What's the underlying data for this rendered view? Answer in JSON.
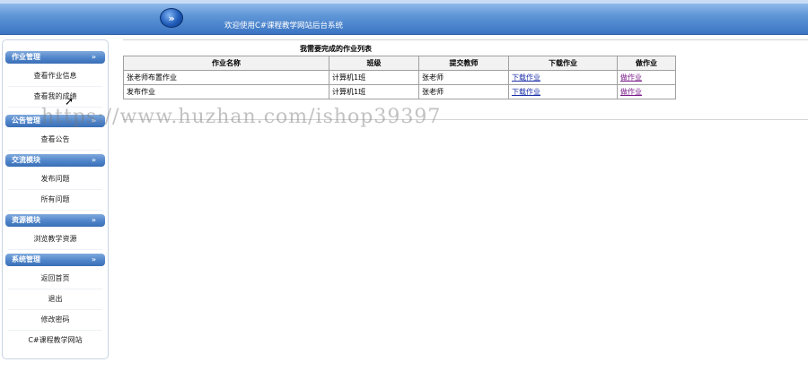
{
  "header": {
    "title": "欢迎使用C#课程教学网站后台系统",
    "logo_glyph": "»"
  },
  "sidebar": {
    "groups": [
      {
        "label": "作业管理",
        "items": [
          "查看作业信息",
          "查看我的成绩"
        ]
      },
      {
        "label": "公告管理",
        "items": [
          "查看公告"
        ]
      },
      {
        "label": "交流模块",
        "items": [
          "发布问题",
          "所有问题"
        ]
      },
      {
        "label": "资源模块",
        "items": [
          "浏览教学资源"
        ]
      },
      {
        "label": "系统管理",
        "items": [
          "返回首页",
          "退出",
          "修改密码",
          "C#课程教学网站"
        ]
      }
    ],
    "chevron": "»"
  },
  "main": {
    "table_title": "我需要完成的作业列表",
    "columns": [
      "作业名称",
      "班级",
      "提交教师",
      "下载作业",
      "做作业"
    ],
    "rows": [
      [
        "张老师布置作业",
        "计算机1班",
        "张老师",
        "下载作业",
        "做作业"
      ],
      [
        "发布作业",
        "计算机1班",
        "张老师",
        "下载作业",
        "做作业"
      ]
    ]
  },
  "watermark": "https://www.huzhan.com/ishop39397",
  "colors": {
    "header_blue": "#3b74c2",
    "menu_head_blue": "#4f84c9",
    "link_blue": "#1b2fa8",
    "link_purple": "#7a1a8a"
  }
}
